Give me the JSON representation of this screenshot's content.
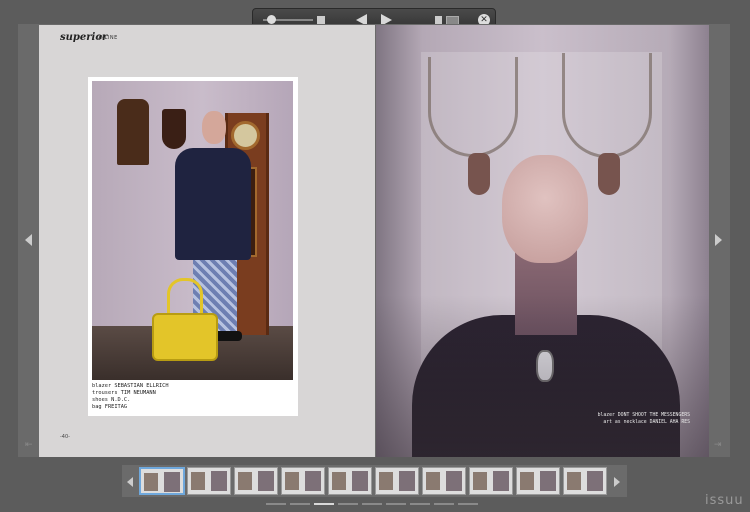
{
  "magazine": {
    "masthead": "superior",
    "masthead_sub": "ONLINE",
    "page_number_left": "-40-"
  },
  "credits": {
    "lines": [
      "blazer  SEBASTIAN ELLRICH",
      "trousers  TIM NEUMANN",
      "shoes  N.D.C.",
      "bag  FREITAG"
    ]
  },
  "caption": {
    "lines": [
      "blazer  DONT SHOOT THE MESSENGERS",
      "art as necklace  DANIEL AHA RES"
    ]
  },
  "brand": "issuu",
  "thumbnails": {
    "count": 10,
    "active_index": 0
  },
  "pager": {
    "count": 9,
    "active_index": 2
  },
  "colors": {
    "viewer_bg": "#5c5c5c",
    "page_left": "#d8d6d6",
    "bag": "#e3c529",
    "active_thumb": "#6fa8dc"
  },
  "icons": {
    "zoom": "zoom-slider-icon",
    "prev": "prev-page-icon",
    "next": "next-page-icon",
    "single": "single-page-icon",
    "spread": "spread-view-icon",
    "close": "close-icon"
  }
}
